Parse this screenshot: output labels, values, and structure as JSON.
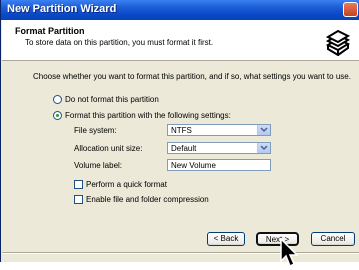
{
  "window": {
    "title": "New Partition Wizard"
  },
  "header": {
    "title": "Format Partition",
    "subtitle": "To store data on this partition, you must format it first.",
    "icon": "disk-icon"
  },
  "main": {
    "intro": "Choose whether you want to format this partition, and if so, what settings you want to use.",
    "options": [
      {
        "label": "Do not format this partition",
        "selected": false
      },
      {
        "label": "Format this partition with the following settings:",
        "selected": true
      }
    ],
    "fields": {
      "file_system": {
        "label": "File system:",
        "value": "NTFS"
      },
      "allocation_unit_size": {
        "label": "Allocation unit size:",
        "value": "Default"
      },
      "volume_label": {
        "label": "Volume label:",
        "value": "New Volume"
      }
    },
    "checkboxes": [
      {
        "label": "Perform a quick format",
        "checked": false
      },
      {
        "label": "Enable file and folder compression",
        "checked": false
      }
    ]
  },
  "buttons": {
    "back": "< Back",
    "next": "Next >",
    "cancel": "Cancel"
  }
}
